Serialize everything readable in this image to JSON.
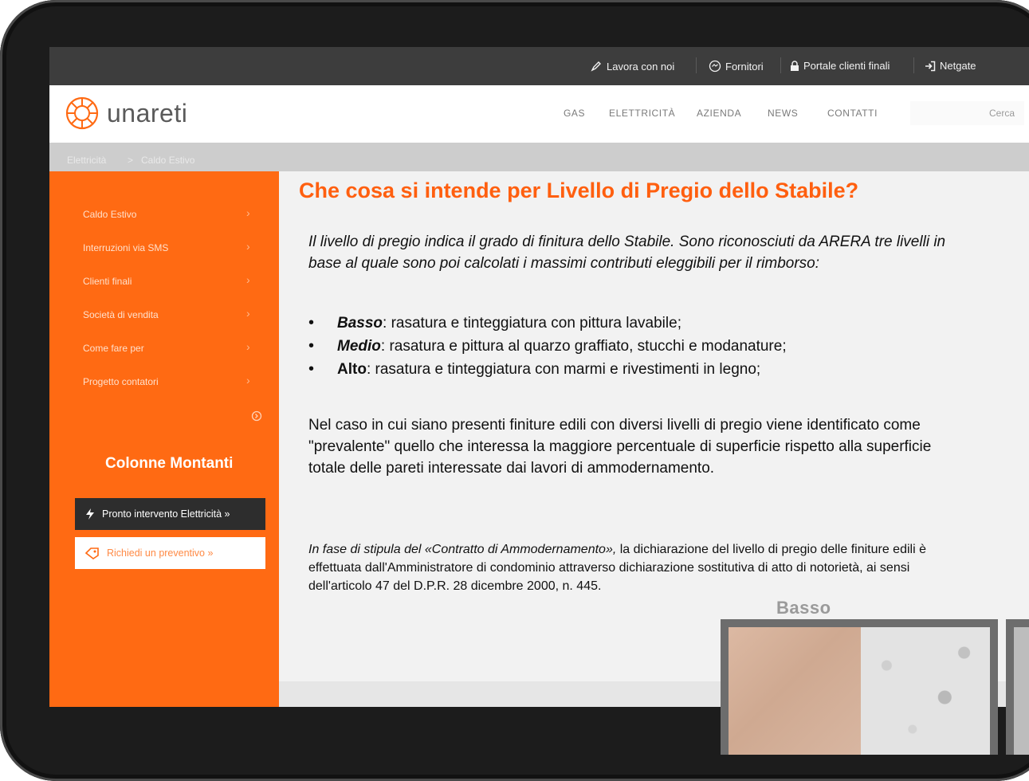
{
  "topbar": {
    "work_with_us": "Lavora con noi",
    "suppliers": "Fornitori",
    "customer_portal": "Portale clienti finali",
    "netgate": "Netgate"
  },
  "header": {
    "logo_text": "unareti",
    "nav": [
      "GAS",
      "ELETTRICITÀ",
      "AZIENDA",
      "NEWS",
      "CONTATTI"
    ],
    "search_placeholder": "Cerca"
  },
  "breadcrumb": {
    "root": "Elettricità",
    "separator": ">",
    "current": "Caldo Estivo"
  },
  "sidebar": {
    "items": [
      "Caldo Estivo",
      "Interruzioni via SMS",
      "Clienti finali",
      "Società di vendita",
      "Come fare per",
      "Progetto contatori"
    ],
    "chevron": "›",
    "heading": "Colonne Montanti",
    "emergency_button": "Pronto intervento Elettricità »",
    "quote_button": "Richiedi un preventivo »"
  },
  "content": {
    "title": "Che cosa si intende per Livello di Pregio dello Stabile?",
    "intro": "Il livello di pregio indica il grado di finitura dello Stabile. Sono riconosciuti da ARERA tre livelli in base al quale sono poi calcolati i massimi contributi eleggibili per il rimborso:",
    "bullet_mark": "•",
    "levels": [
      {
        "name": "Basso",
        "desc": ": rasatura e tinteggiatura con pittura lavabile;"
      },
      {
        "name": "Medio",
        "desc": ": rasatura e pittura al quarzo graffiato, stucchi e modanature;"
      },
      {
        "name": "Alto",
        "desc": ": rasatura e tinteggiatura con marmi e rivestimenti in legno;"
      }
    ],
    "paragraph": "Nel caso in cui siano presenti finiture edili con diversi livelli di pregio viene identificato come \"prevalente\" quello che interessa la maggiore percentuale di superficie rispetto alla superficie totale delle pareti interessate dai lavori di ammodernamento.",
    "note_italic": "In fase di stipula del «Contratto di Ammodernamento»,",
    "note_rest": " la dichiarazione del livello di pregio delle finiture edili è effettuata dall'Amministratore di condominio attraverso dichiarazione sostitutiva di atto di notorietà, ai sensi dell'articolo 47 del D.P.R. 28 dicembre 2000, n. 445."
  },
  "overlay": {
    "label": "Basso"
  },
  "colors": {
    "brand_orange": "#ff6a13",
    "title_orange": "#ff5f0f",
    "topbar": "#3d3d3d",
    "dark_button": "#2d2d2d"
  }
}
